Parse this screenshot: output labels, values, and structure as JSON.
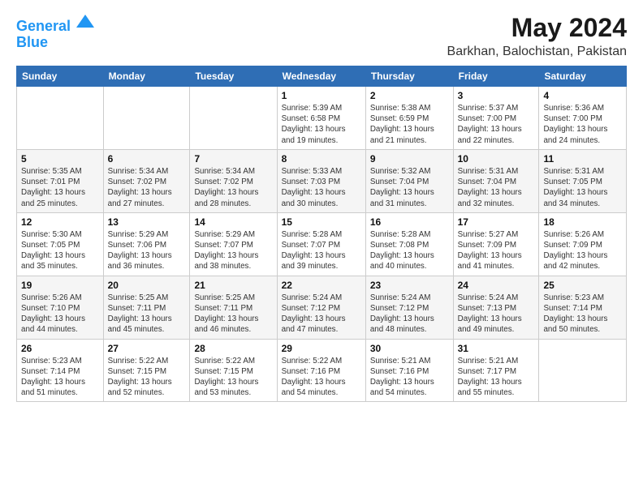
{
  "logo": {
    "line1": "General",
    "line2": "Blue"
  },
  "title": "May 2024",
  "subtitle": "Barkhan, Balochistan, Pakistan",
  "weekdays": [
    "Sunday",
    "Monday",
    "Tuesday",
    "Wednesday",
    "Thursday",
    "Friday",
    "Saturday"
  ],
  "weeks": [
    [
      {
        "day": "",
        "info": ""
      },
      {
        "day": "",
        "info": ""
      },
      {
        "day": "",
        "info": ""
      },
      {
        "day": "1",
        "info": "Sunrise: 5:39 AM\nSunset: 6:58 PM\nDaylight: 13 hours\nand 19 minutes."
      },
      {
        "day": "2",
        "info": "Sunrise: 5:38 AM\nSunset: 6:59 PM\nDaylight: 13 hours\nand 21 minutes."
      },
      {
        "day": "3",
        "info": "Sunrise: 5:37 AM\nSunset: 7:00 PM\nDaylight: 13 hours\nand 22 minutes."
      },
      {
        "day": "4",
        "info": "Sunrise: 5:36 AM\nSunset: 7:00 PM\nDaylight: 13 hours\nand 24 minutes."
      }
    ],
    [
      {
        "day": "5",
        "info": "Sunrise: 5:35 AM\nSunset: 7:01 PM\nDaylight: 13 hours\nand 25 minutes."
      },
      {
        "day": "6",
        "info": "Sunrise: 5:34 AM\nSunset: 7:02 PM\nDaylight: 13 hours\nand 27 minutes."
      },
      {
        "day": "7",
        "info": "Sunrise: 5:34 AM\nSunset: 7:02 PM\nDaylight: 13 hours\nand 28 minutes."
      },
      {
        "day": "8",
        "info": "Sunrise: 5:33 AM\nSunset: 7:03 PM\nDaylight: 13 hours\nand 30 minutes."
      },
      {
        "day": "9",
        "info": "Sunrise: 5:32 AM\nSunset: 7:04 PM\nDaylight: 13 hours\nand 31 minutes."
      },
      {
        "day": "10",
        "info": "Sunrise: 5:31 AM\nSunset: 7:04 PM\nDaylight: 13 hours\nand 32 minutes."
      },
      {
        "day": "11",
        "info": "Sunrise: 5:31 AM\nSunset: 7:05 PM\nDaylight: 13 hours\nand 34 minutes."
      }
    ],
    [
      {
        "day": "12",
        "info": "Sunrise: 5:30 AM\nSunset: 7:05 PM\nDaylight: 13 hours\nand 35 minutes."
      },
      {
        "day": "13",
        "info": "Sunrise: 5:29 AM\nSunset: 7:06 PM\nDaylight: 13 hours\nand 36 minutes."
      },
      {
        "day": "14",
        "info": "Sunrise: 5:29 AM\nSunset: 7:07 PM\nDaylight: 13 hours\nand 38 minutes."
      },
      {
        "day": "15",
        "info": "Sunrise: 5:28 AM\nSunset: 7:07 PM\nDaylight: 13 hours\nand 39 minutes."
      },
      {
        "day": "16",
        "info": "Sunrise: 5:28 AM\nSunset: 7:08 PM\nDaylight: 13 hours\nand 40 minutes."
      },
      {
        "day": "17",
        "info": "Sunrise: 5:27 AM\nSunset: 7:09 PM\nDaylight: 13 hours\nand 41 minutes."
      },
      {
        "day": "18",
        "info": "Sunrise: 5:26 AM\nSunset: 7:09 PM\nDaylight: 13 hours\nand 42 minutes."
      }
    ],
    [
      {
        "day": "19",
        "info": "Sunrise: 5:26 AM\nSunset: 7:10 PM\nDaylight: 13 hours\nand 44 minutes."
      },
      {
        "day": "20",
        "info": "Sunrise: 5:25 AM\nSunset: 7:11 PM\nDaylight: 13 hours\nand 45 minutes."
      },
      {
        "day": "21",
        "info": "Sunrise: 5:25 AM\nSunset: 7:11 PM\nDaylight: 13 hours\nand 46 minutes."
      },
      {
        "day": "22",
        "info": "Sunrise: 5:24 AM\nSunset: 7:12 PM\nDaylight: 13 hours\nand 47 minutes."
      },
      {
        "day": "23",
        "info": "Sunrise: 5:24 AM\nSunset: 7:12 PM\nDaylight: 13 hours\nand 48 minutes."
      },
      {
        "day": "24",
        "info": "Sunrise: 5:24 AM\nSunset: 7:13 PM\nDaylight: 13 hours\nand 49 minutes."
      },
      {
        "day": "25",
        "info": "Sunrise: 5:23 AM\nSunset: 7:14 PM\nDaylight: 13 hours\nand 50 minutes."
      }
    ],
    [
      {
        "day": "26",
        "info": "Sunrise: 5:23 AM\nSunset: 7:14 PM\nDaylight: 13 hours\nand 51 minutes."
      },
      {
        "day": "27",
        "info": "Sunrise: 5:22 AM\nSunset: 7:15 PM\nDaylight: 13 hours\nand 52 minutes."
      },
      {
        "day": "28",
        "info": "Sunrise: 5:22 AM\nSunset: 7:15 PM\nDaylight: 13 hours\nand 53 minutes."
      },
      {
        "day": "29",
        "info": "Sunrise: 5:22 AM\nSunset: 7:16 PM\nDaylight: 13 hours\nand 54 minutes."
      },
      {
        "day": "30",
        "info": "Sunrise: 5:21 AM\nSunset: 7:16 PM\nDaylight: 13 hours\nand 54 minutes."
      },
      {
        "day": "31",
        "info": "Sunrise: 5:21 AM\nSunset: 7:17 PM\nDaylight: 13 hours\nand 55 minutes."
      },
      {
        "day": "",
        "info": ""
      }
    ]
  ]
}
